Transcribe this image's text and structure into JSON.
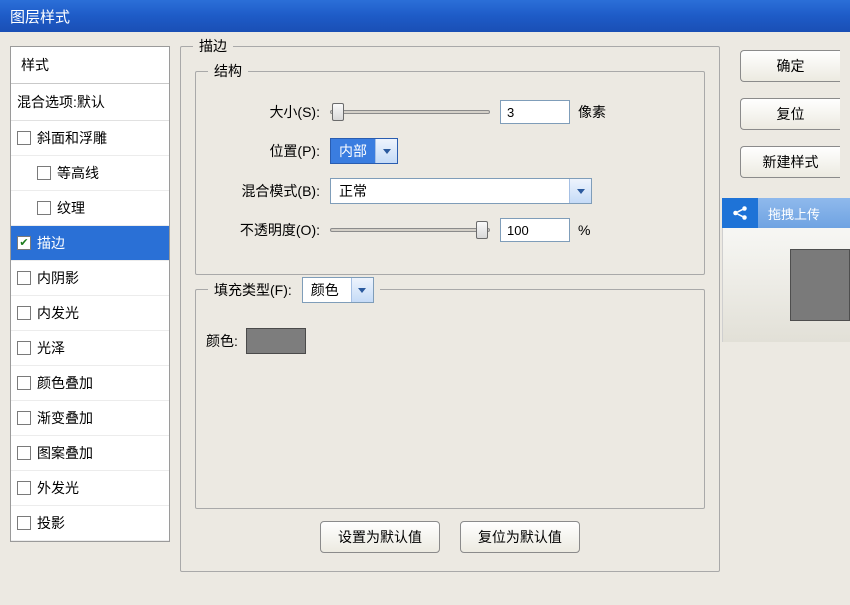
{
  "title": "图层样式",
  "styles_header": "样式",
  "blend_option": "混合选项:默认",
  "items": [
    {
      "label": "斜面和浮雕",
      "checked": false,
      "indent": false,
      "selected": false,
      "name": "item-bevel-emboss"
    },
    {
      "label": "等高线",
      "checked": false,
      "indent": true,
      "selected": false,
      "name": "item-contour"
    },
    {
      "label": "纹理",
      "checked": false,
      "indent": true,
      "selected": false,
      "name": "item-texture"
    },
    {
      "label": "描边",
      "checked": true,
      "indent": false,
      "selected": true,
      "name": "item-stroke"
    },
    {
      "label": "内阴影",
      "checked": false,
      "indent": false,
      "selected": false,
      "name": "item-inner-shadow"
    },
    {
      "label": "内发光",
      "checked": false,
      "indent": false,
      "selected": false,
      "name": "item-inner-glow"
    },
    {
      "label": "光泽",
      "checked": false,
      "indent": false,
      "selected": false,
      "name": "item-satin"
    },
    {
      "label": "颜色叠加",
      "checked": false,
      "indent": false,
      "selected": false,
      "name": "item-color-overlay"
    },
    {
      "label": "渐变叠加",
      "checked": false,
      "indent": false,
      "selected": false,
      "name": "item-gradient-overlay"
    },
    {
      "label": "图案叠加",
      "checked": false,
      "indent": false,
      "selected": false,
      "name": "item-pattern-overlay"
    },
    {
      "label": "外发光",
      "checked": false,
      "indent": false,
      "selected": false,
      "name": "item-outer-glow"
    },
    {
      "label": "投影",
      "checked": false,
      "indent": false,
      "selected": false,
      "name": "item-drop-shadow"
    }
  ],
  "panel": {
    "outer_legend": "描边",
    "struct_legend": "结构",
    "size_label": "大小(S):",
    "size_value": "3",
    "size_unit": "像素",
    "position_label": "位置(P):",
    "position_value": "内部",
    "blend_label": "混合模式(B):",
    "blend_value": "正常",
    "opacity_label": "不透明度(O):",
    "opacity_value": "100",
    "opacity_unit": "%",
    "fill_legend": "填充类型(F):",
    "fill_value": "颜色",
    "color_label": "颜色:",
    "color_swatch": "#7d7d7d",
    "set_default": "设置为默认值",
    "reset_default": "复位为默认值"
  },
  "buttons": {
    "ok": "确定",
    "reset": "复位",
    "new_style": "新建样式"
  },
  "float_panel_label": "拖拽上传"
}
